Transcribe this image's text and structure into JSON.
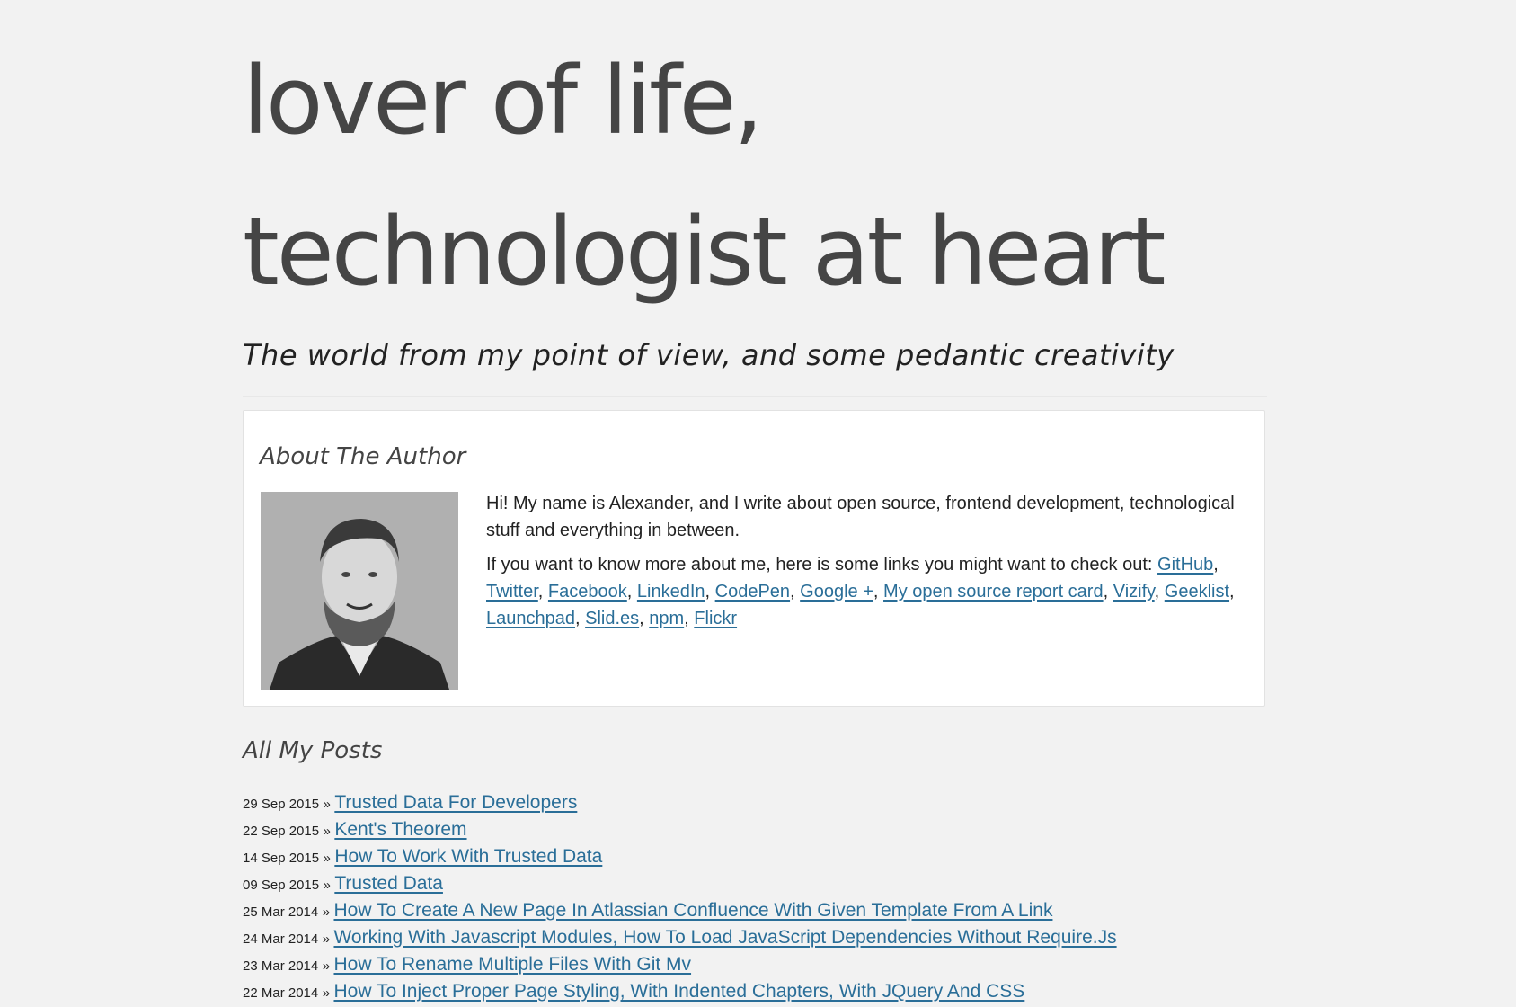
{
  "header": {
    "title_line1": "lover of life,",
    "title_line2": "technologist at heart",
    "subtitle": "The world from my point of view, and some pedantic creativity"
  },
  "about": {
    "heading": "About The Author",
    "avatar_alt": "portrait photo",
    "intro": "Hi! My name is Alexander, and I write about open source, frontend development, technological stuff and everything in between.",
    "links_intro": "If you want to know more about me, here is some links you might want to check out:",
    "links": [
      "GitHub",
      "Twitter",
      "Facebook",
      "LinkedIn",
      "CodePen",
      "Google +",
      "My open source report card",
      "Vizify",
      "Geeklist",
      "Launchpad",
      "Slid.es",
      "npm",
      "Flickr"
    ]
  },
  "posts": {
    "heading": "All My Posts",
    "separator": "»",
    "items": [
      {
        "date": "29 Sep 2015",
        "title": "Trusted Data For Developers"
      },
      {
        "date": "22 Sep 2015",
        "title": "Kent's Theorem"
      },
      {
        "date": "14 Sep 2015",
        "title": "How To Work With Trusted Data"
      },
      {
        "date": "09 Sep 2015",
        "title": "Trusted Data"
      },
      {
        "date": "25 Mar 2014",
        "title": "How To Create A New Page In Atlassian Confluence With Given Template From A Link"
      },
      {
        "date": "24 Mar 2014",
        "title": "Working With Javascript Modules, How To Load JavaScript Dependencies Without Require.Js"
      },
      {
        "date": "23 Mar 2014",
        "title": "How To Rename Multiple Files With Git Mv"
      },
      {
        "date": "22 Mar 2014",
        "title": "How To Inject Proper Page Styling, With Indented Chapters, With JQuery And CSS"
      }
    ]
  },
  "colors": {
    "background": "#f2f2f2",
    "link": "#2a6e98",
    "title": "#454545"
  }
}
